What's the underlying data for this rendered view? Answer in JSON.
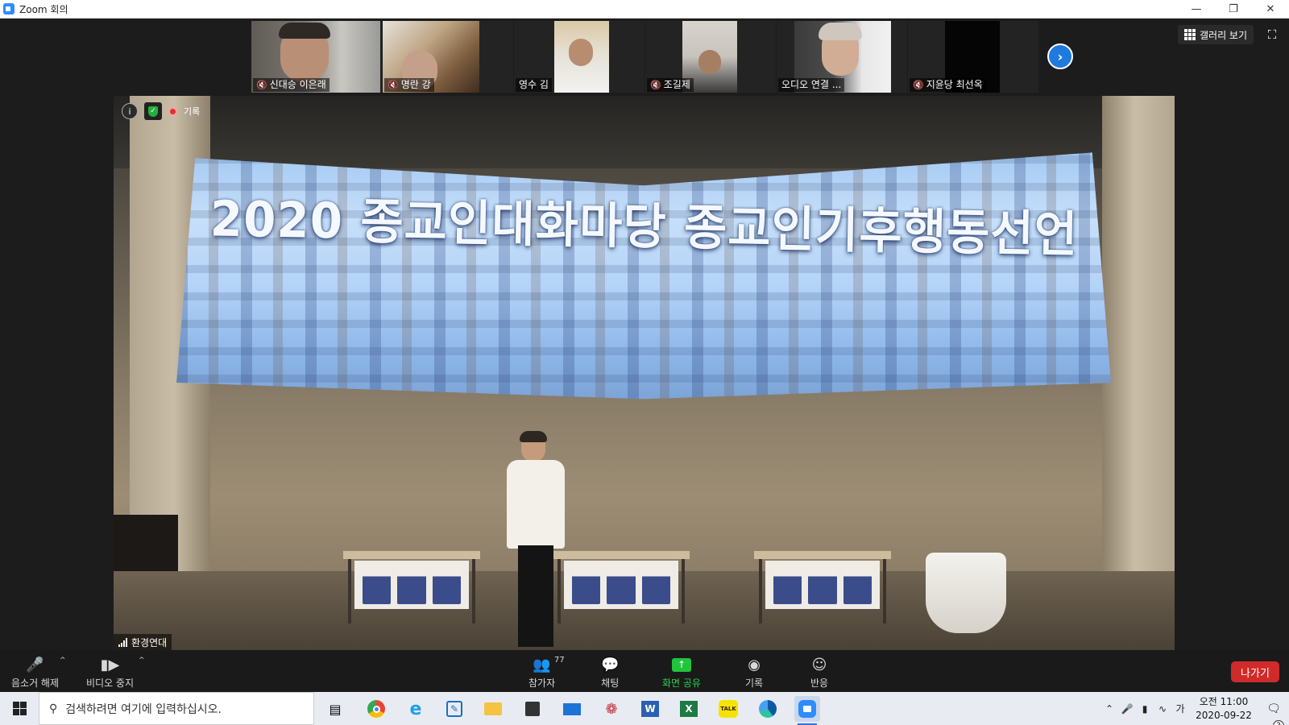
{
  "window": {
    "title": "Zoom 회의",
    "controls": [
      "minimize",
      "restore",
      "close"
    ]
  },
  "participants": [
    {
      "name": "신대승 이은래",
      "muted": true
    },
    {
      "name": "명란 강",
      "muted": true
    },
    {
      "name": "영수 김",
      "muted": false
    },
    {
      "name": "조길제",
      "muted": true
    },
    {
      "name": "오디오 연결 ...",
      "muted": false
    },
    {
      "name": "지윤당 최선옥",
      "muted": true
    }
  ],
  "view": {
    "gallery_label": "갤러리 보기"
  },
  "main_video": {
    "recording_label": "기록",
    "screen_text": "2020 종교인대화마당 종교인기후행동선언",
    "speaker_name": "환경연대"
  },
  "toolbar": {
    "unmute_label": "음소거 해제",
    "stop_video_label": "비디오 중지",
    "participants_label": "참가자",
    "participants_count": "77",
    "chat_label": "채팅",
    "share_label": "화면 공유",
    "record_label": "기록",
    "reactions_label": "반응",
    "leave_label": "나가기"
  },
  "taskbar": {
    "search_placeholder": "검색하려면 여기에 입력하십시오.",
    "apps": [
      "task-view",
      "chrome",
      "internet-explorer",
      "notes",
      "file-explorer",
      "store",
      "mail",
      "paint",
      "word",
      "excel",
      "kakaotalk",
      "edge",
      "zoom"
    ],
    "kakaotalk_label": "TALK",
    "ime_label": "가",
    "clock_time": "오전 11:00",
    "clock_date": "2020-09-22",
    "notification_count": "2"
  },
  "colors": {
    "leave": "#d02a2a",
    "share_green": "#22c43c",
    "next_blue": "#1f7ae0",
    "muted_red": "#e02828"
  }
}
